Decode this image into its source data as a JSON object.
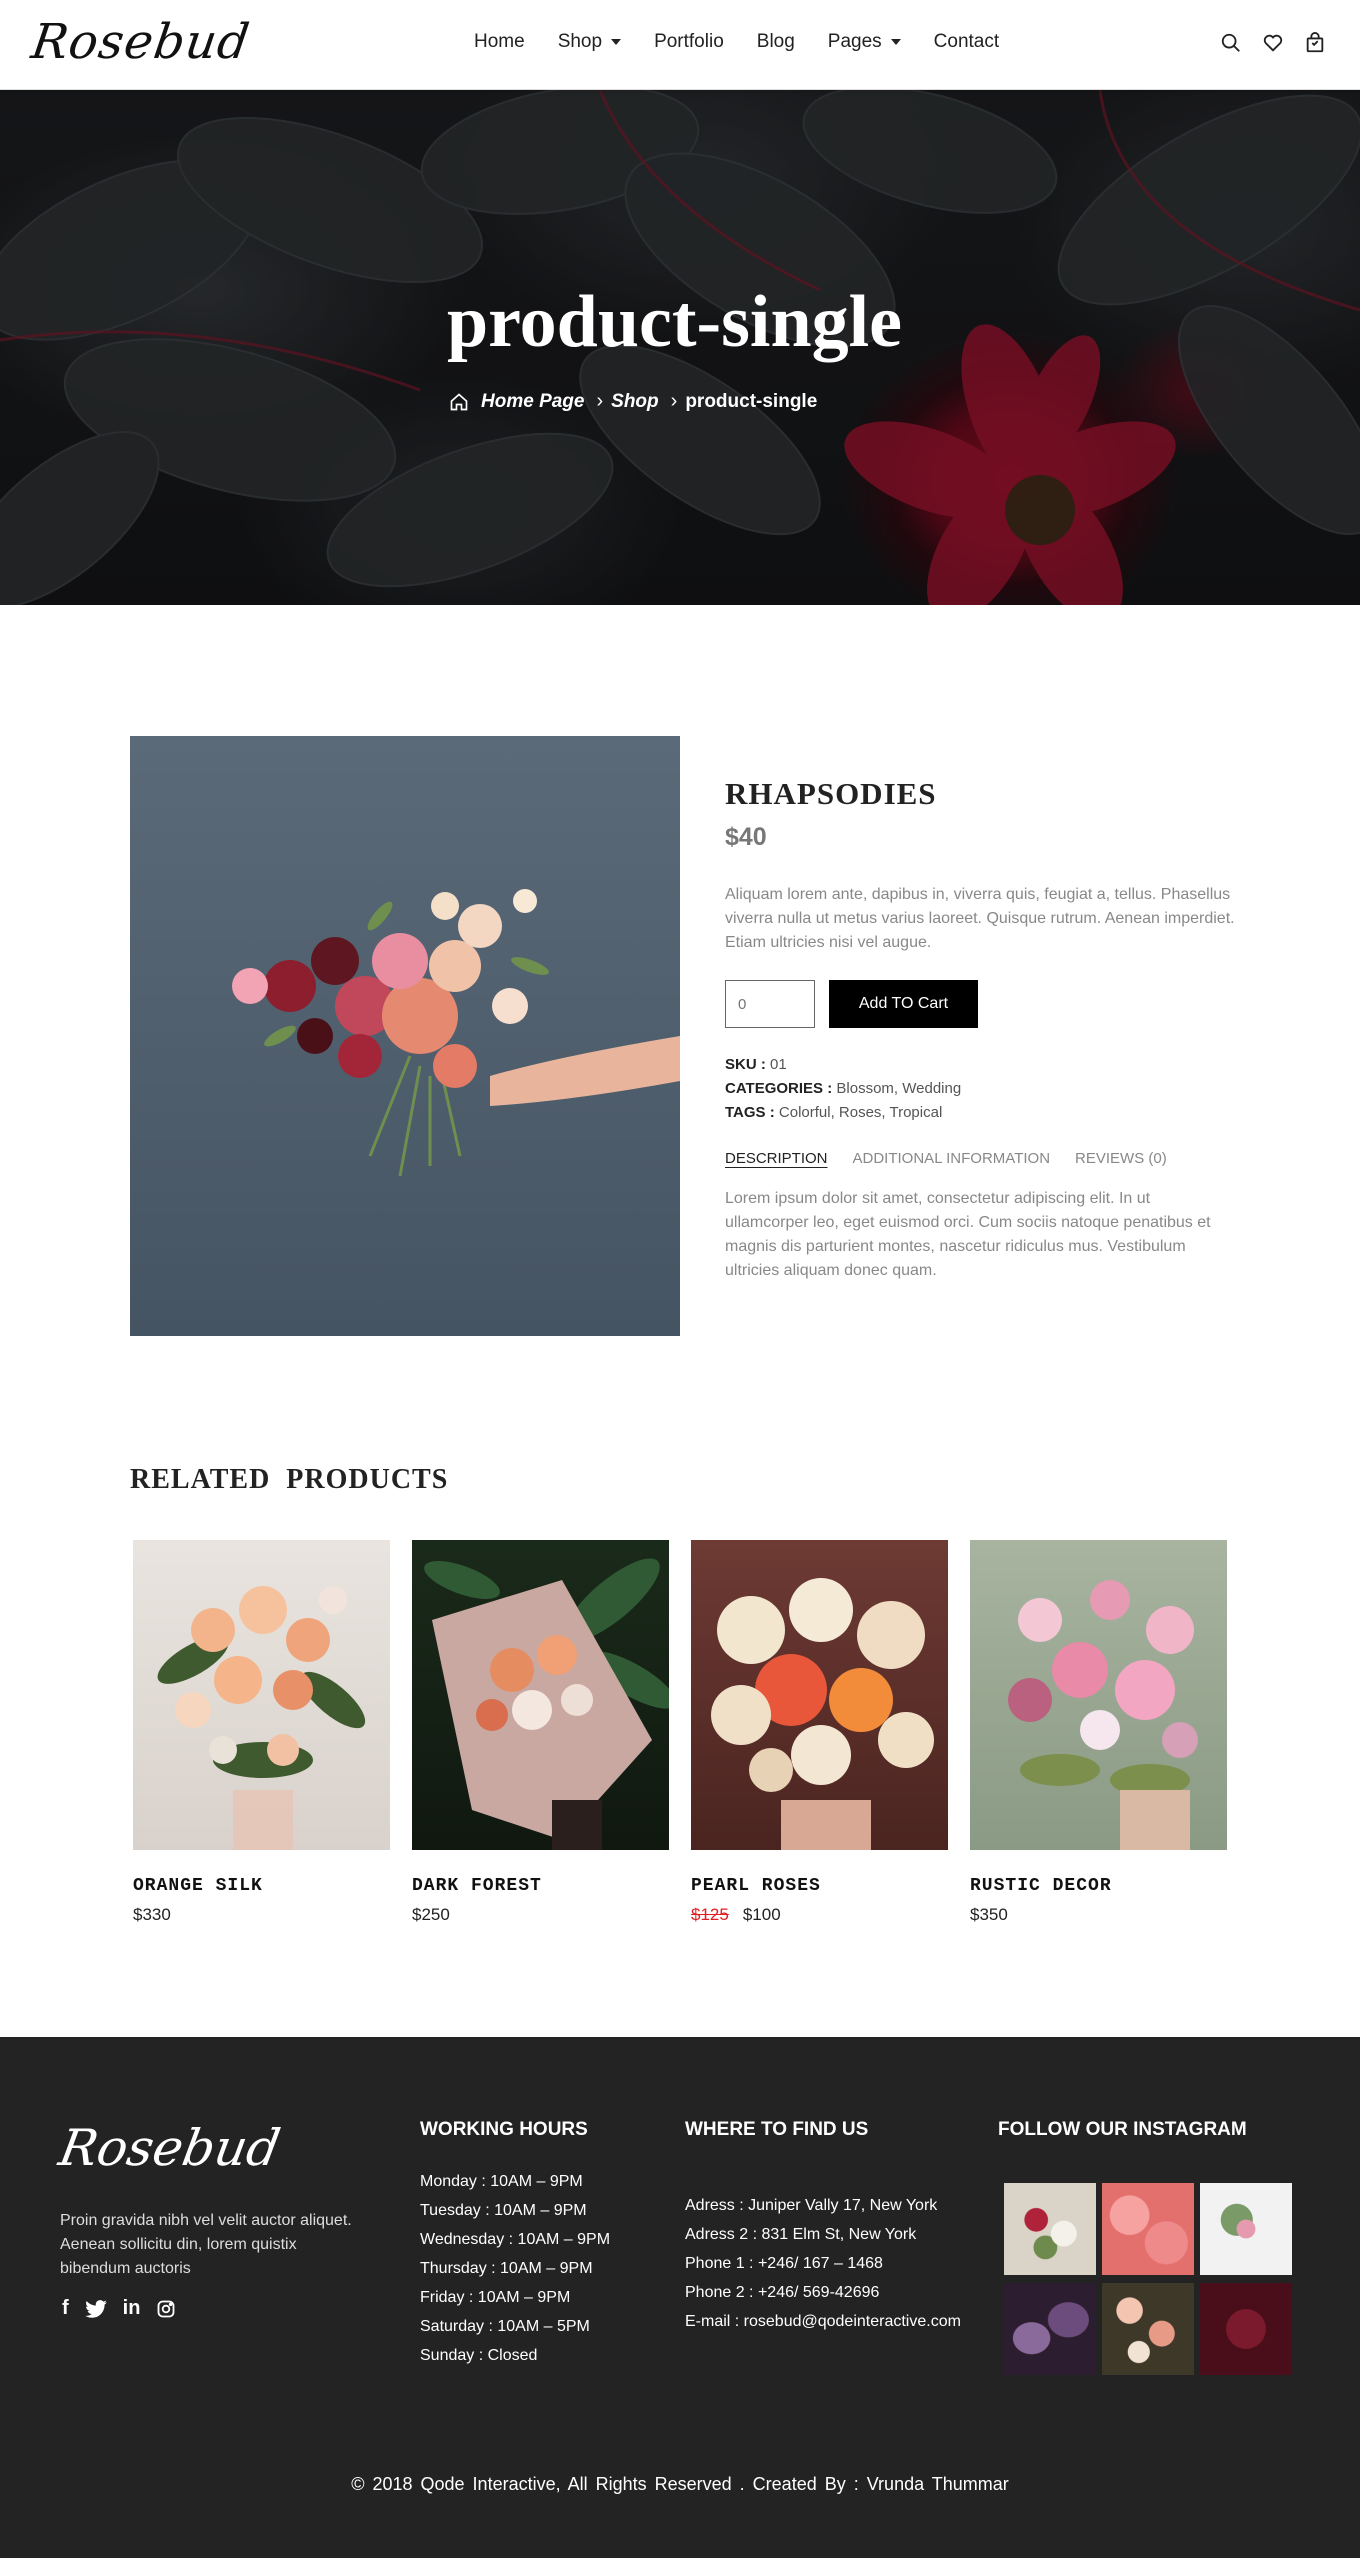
{
  "header": {
    "logo": "Rosebud",
    "nav": [
      {
        "label": "Home",
        "dropdown": false
      },
      {
        "label": "Shop",
        "dropdown": true
      },
      {
        "label": "Portfolio",
        "dropdown": false
      },
      {
        "label": "Blog",
        "dropdown": false
      },
      {
        "label": "Pages",
        "dropdown": true
      },
      {
        "label": "Contact",
        "dropdown": false
      }
    ],
    "icons": [
      "search-icon",
      "heart-icon",
      "cart-icon"
    ]
  },
  "hero": {
    "title": "product-single",
    "breadcrumb": {
      "home": "Home Page",
      "shop": "Shop",
      "current": "product-single"
    }
  },
  "product": {
    "name": "RHAPSODIES",
    "price": "$40",
    "description": "Aliquam lorem ante, dapibus in, viverra quis, feugiat a, tellus. Phasellus viverra nulla ut metus varius laoreet. Quisque rutrum. Aenean imperdiet. Etiam ultricies nisi vel augue.",
    "quantity_placeholder": "0",
    "add_to_cart": "Add TO Cart",
    "sku_label": "SKU :",
    "sku": "01",
    "categories_label": "CATEGORIES :",
    "categories": "Blossom, Wedding",
    "tags_label": "TAGS :",
    "tags": "Colorful, Roses, Tropical",
    "tabs": [
      "DESCRIPTION",
      "ADDITIONAL INFORMATION",
      "REVIEWS (0)"
    ],
    "tab_content": "Lorem ipsum dolor sit amet, consectetur adipiscing elit. In ut ullamcorper leo, eget euismod orci. Cum sociis natoque penatibus et magnis dis parturient montes, nascetur ridiculus mus. Vestibulum ultricies aliquam donec quam."
  },
  "related": {
    "title": "RELATED PRODUCTS",
    "items": [
      {
        "name": "ORANGE SILK",
        "price": "$330",
        "old_price": ""
      },
      {
        "name": "DARK FOREST",
        "price": "$250",
        "old_price": ""
      },
      {
        "name": "PEARL ROSES",
        "price": "$100",
        "old_price": "$125"
      },
      {
        "name": "RUSTIC DECOR",
        "price": "$350",
        "old_price": ""
      }
    ]
  },
  "footer": {
    "logo": "Rosebud",
    "about": "Proin gravida nibh vel velit auctor aliquet. Aenean sollicitu din, lorem quistix bibendum auctoris",
    "social": [
      "facebook-icon",
      "twitter-icon",
      "linkedin-icon",
      "instagram-icon"
    ],
    "hours_title": "WORKING HOURS",
    "hours": [
      "Monday : 10AM – 9PM",
      "Tuesday : 10AM – 9PM",
      "Wednesday : 10AM – 9PM",
      "Thursday : 10AM – 9PM",
      "Friday : 10AM – 9PM",
      "Saturday : 10AM – 5PM",
      "Sunday : Closed"
    ],
    "find_title": "WHERE TO FIND US",
    "find": [
      "Adress : Juniper Vally 17, New York",
      "Adress 2 : 831 Elm St, New York",
      "Phone 1 : +246/ 167 – 1468",
      "Phone 2 : +246/ 569-42696",
      "E-mail : rosebud@qodeinteractive.com"
    ],
    "instagram_title": "FOLLOW OUR INSTAGRAM",
    "copyright": "© 2018 Qode Interactive, All Rights Reserved . Created By : Vrunda Thummar"
  },
  "colors": {
    "accent": "#000000",
    "sale_red": "#e02020",
    "footer_bg": "#232323"
  }
}
